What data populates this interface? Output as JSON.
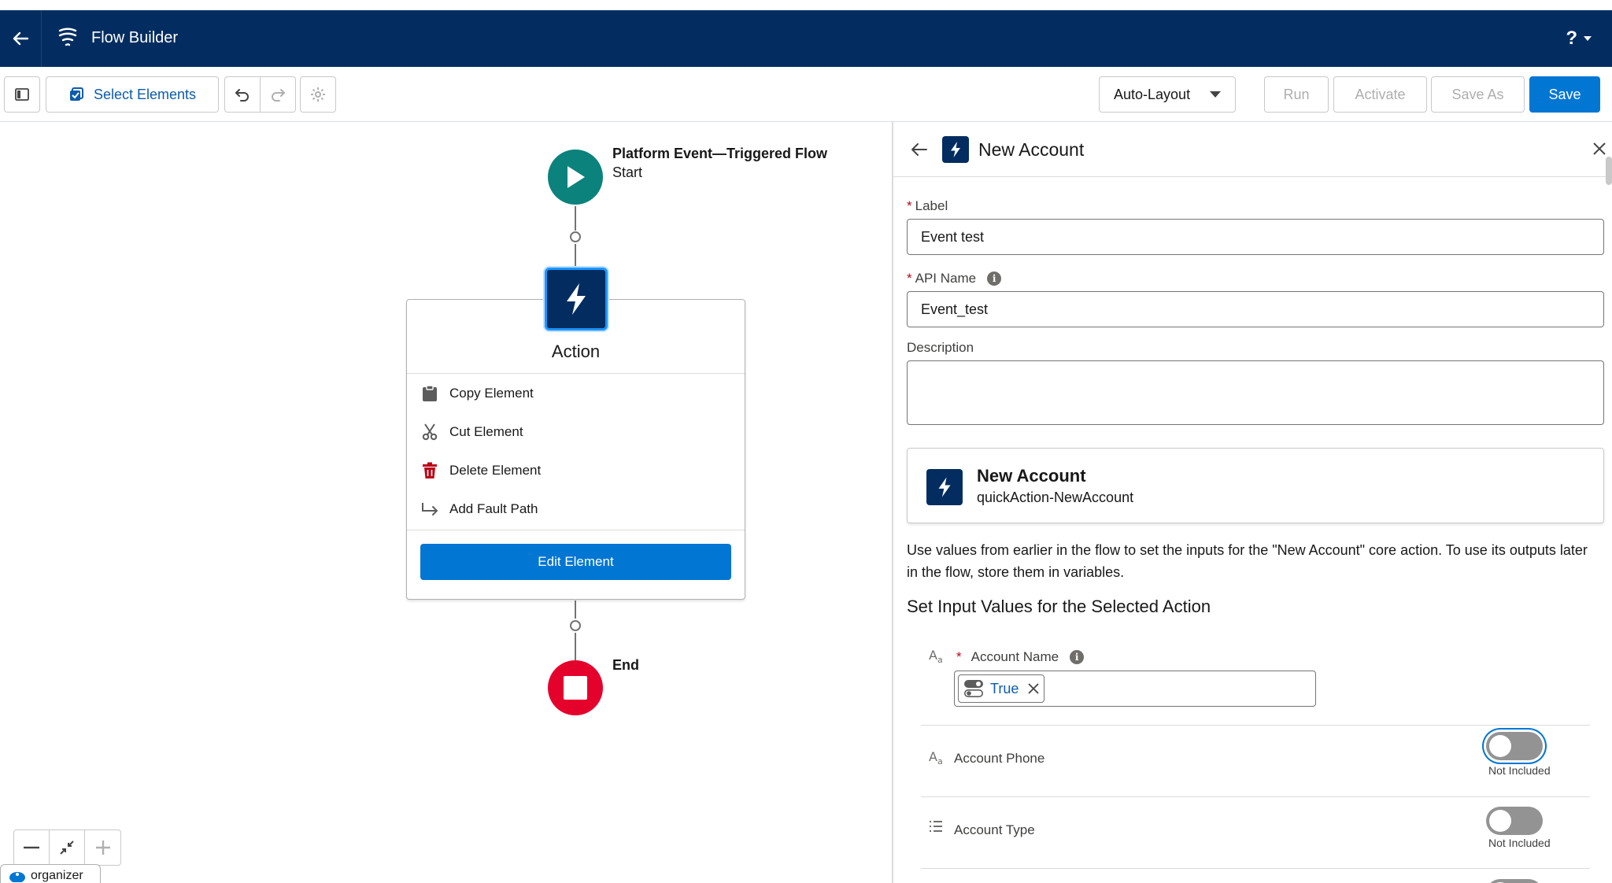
{
  "header": {
    "title": "Flow Builder",
    "help": "?"
  },
  "toolbar": {
    "select_elements": "Select Elements",
    "layout_select": "Auto-Layout",
    "run": "Run",
    "activate": "Activate",
    "save_as": "Save As",
    "save": "Save"
  },
  "canvas": {
    "start": {
      "title": "Platform Event—Triggered Flow",
      "subtitle": "Start"
    },
    "action": {
      "label": "Action",
      "menu": [
        {
          "label": "Copy Element",
          "icon": "clipboard-icon"
        },
        {
          "label": "Cut Element",
          "icon": "scissors-icon"
        },
        {
          "label": "Delete Element",
          "icon": "trash-icon"
        },
        {
          "label": "Add Fault Path",
          "icon": "fault-path-icon"
        }
      ],
      "edit_button": "Edit Element"
    },
    "end": {
      "label": "End"
    },
    "organizer": "organizer"
  },
  "panel": {
    "title": "New Account",
    "label": {
      "name": "Label",
      "value": "Event test"
    },
    "api_name": {
      "name": "API Name",
      "value": "Event_test"
    },
    "description": {
      "name": "Description",
      "value": ""
    },
    "action": {
      "name": "New Account",
      "api": "quickAction-NewAccount"
    },
    "help_text": "Use values from earlier in the flow to set the inputs for the \"New Account\" core action. To use its outputs later in the flow, store them in variables.",
    "section_title": "Set Input Values for the Selected Action",
    "params": [
      {
        "label": "Account Name",
        "required": true,
        "value": "True"
      },
      {
        "label": "Account Phone",
        "toggle": "Not Included"
      },
      {
        "label": "Account Type",
        "toggle": "Not Included"
      }
    ]
  },
  "colors": {
    "header_bg": "#032d60",
    "brand_blue": "#0176d3",
    "start_green": "#0b827c",
    "end_red": "#e4022d"
  }
}
